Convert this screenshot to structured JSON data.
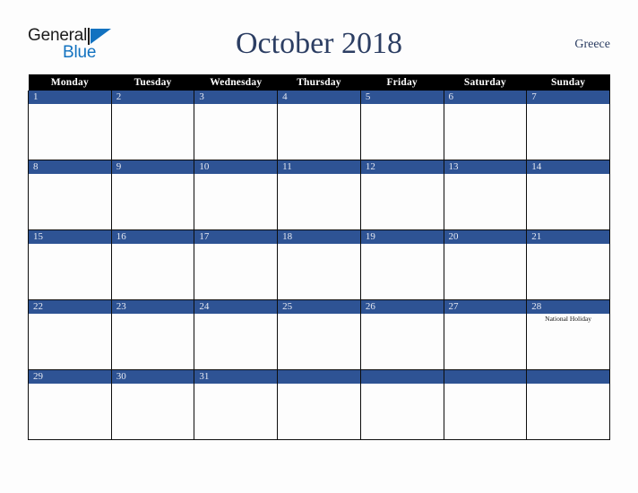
{
  "brand": {
    "word_one": "General",
    "word_two": "Blue",
    "triangle_icon": "blue-triangle-icon",
    "accent_color": "#1272c0"
  },
  "header": {
    "title": "October 2018",
    "country": "Greece",
    "title_color": "#2c3e63"
  },
  "calendar": {
    "weekday_headers": [
      "Monday",
      "Tuesday",
      "Wednesday",
      "Thursday",
      "Friday",
      "Saturday",
      "Sunday"
    ],
    "header_bg": "#000000",
    "daynum_bg": "#2e5394",
    "daynum_color": "#e6e9f2",
    "weeks": [
      [
        {
          "day": "1",
          "events": []
        },
        {
          "day": "2",
          "events": []
        },
        {
          "day": "3",
          "events": []
        },
        {
          "day": "4",
          "events": []
        },
        {
          "day": "5",
          "events": []
        },
        {
          "day": "6",
          "events": []
        },
        {
          "day": "7",
          "events": []
        }
      ],
      [
        {
          "day": "8",
          "events": []
        },
        {
          "day": "9",
          "events": []
        },
        {
          "day": "10",
          "events": []
        },
        {
          "day": "11",
          "events": []
        },
        {
          "day": "12",
          "events": []
        },
        {
          "day": "13",
          "events": []
        },
        {
          "day": "14",
          "events": []
        }
      ],
      [
        {
          "day": "15",
          "events": []
        },
        {
          "day": "16",
          "events": []
        },
        {
          "day": "17",
          "events": []
        },
        {
          "day": "18",
          "events": []
        },
        {
          "day": "19",
          "events": []
        },
        {
          "day": "20",
          "events": []
        },
        {
          "day": "21",
          "events": []
        }
      ],
      [
        {
          "day": "22",
          "events": []
        },
        {
          "day": "23",
          "events": []
        },
        {
          "day": "24",
          "events": []
        },
        {
          "day": "25",
          "events": []
        },
        {
          "day": "26",
          "events": []
        },
        {
          "day": "27",
          "events": []
        },
        {
          "day": "28",
          "events": [
            "National Holiday"
          ]
        }
      ],
      [
        {
          "day": "29",
          "events": []
        },
        {
          "day": "30",
          "events": []
        },
        {
          "day": "31",
          "events": []
        },
        {
          "day": "",
          "events": []
        },
        {
          "day": "",
          "events": []
        },
        {
          "day": "",
          "events": []
        },
        {
          "day": "",
          "events": []
        }
      ]
    ]
  }
}
